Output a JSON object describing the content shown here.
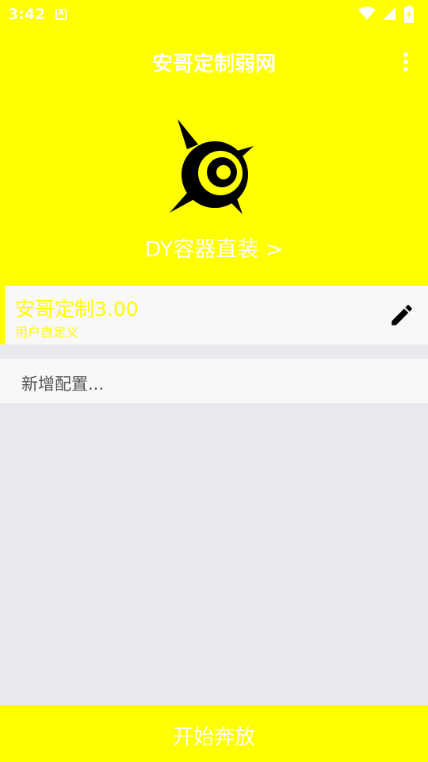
{
  "status_bar": {
    "time": "3:42",
    "icons": [
      "a-notification-icon",
      "wifi-icon",
      "signal-icon",
      "battery-icon"
    ]
  },
  "app_bar": {
    "title": "安哥定制弱网",
    "menu_icon": "more-vert-icon"
  },
  "hero": {
    "logo_icon": "compass-eye-logo",
    "install_link": "DY容器直装 >"
  },
  "config_list": {
    "items": [
      {
        "title": "安哥定制3.00",
        "subtitle": "用户自定义",
        "edit_icon": "pencil-icon"
      }
    ],
    "add_label": "新增配置..."
  },
  "footer": {
    "start_label": "开始奔放"
  },
  "colors": {
    "primary": "#ffff00",
    "on_primary": "#ffffff",
    "background": "#e8e9ef",
    "card": "#f8f8f8"
  }
}
